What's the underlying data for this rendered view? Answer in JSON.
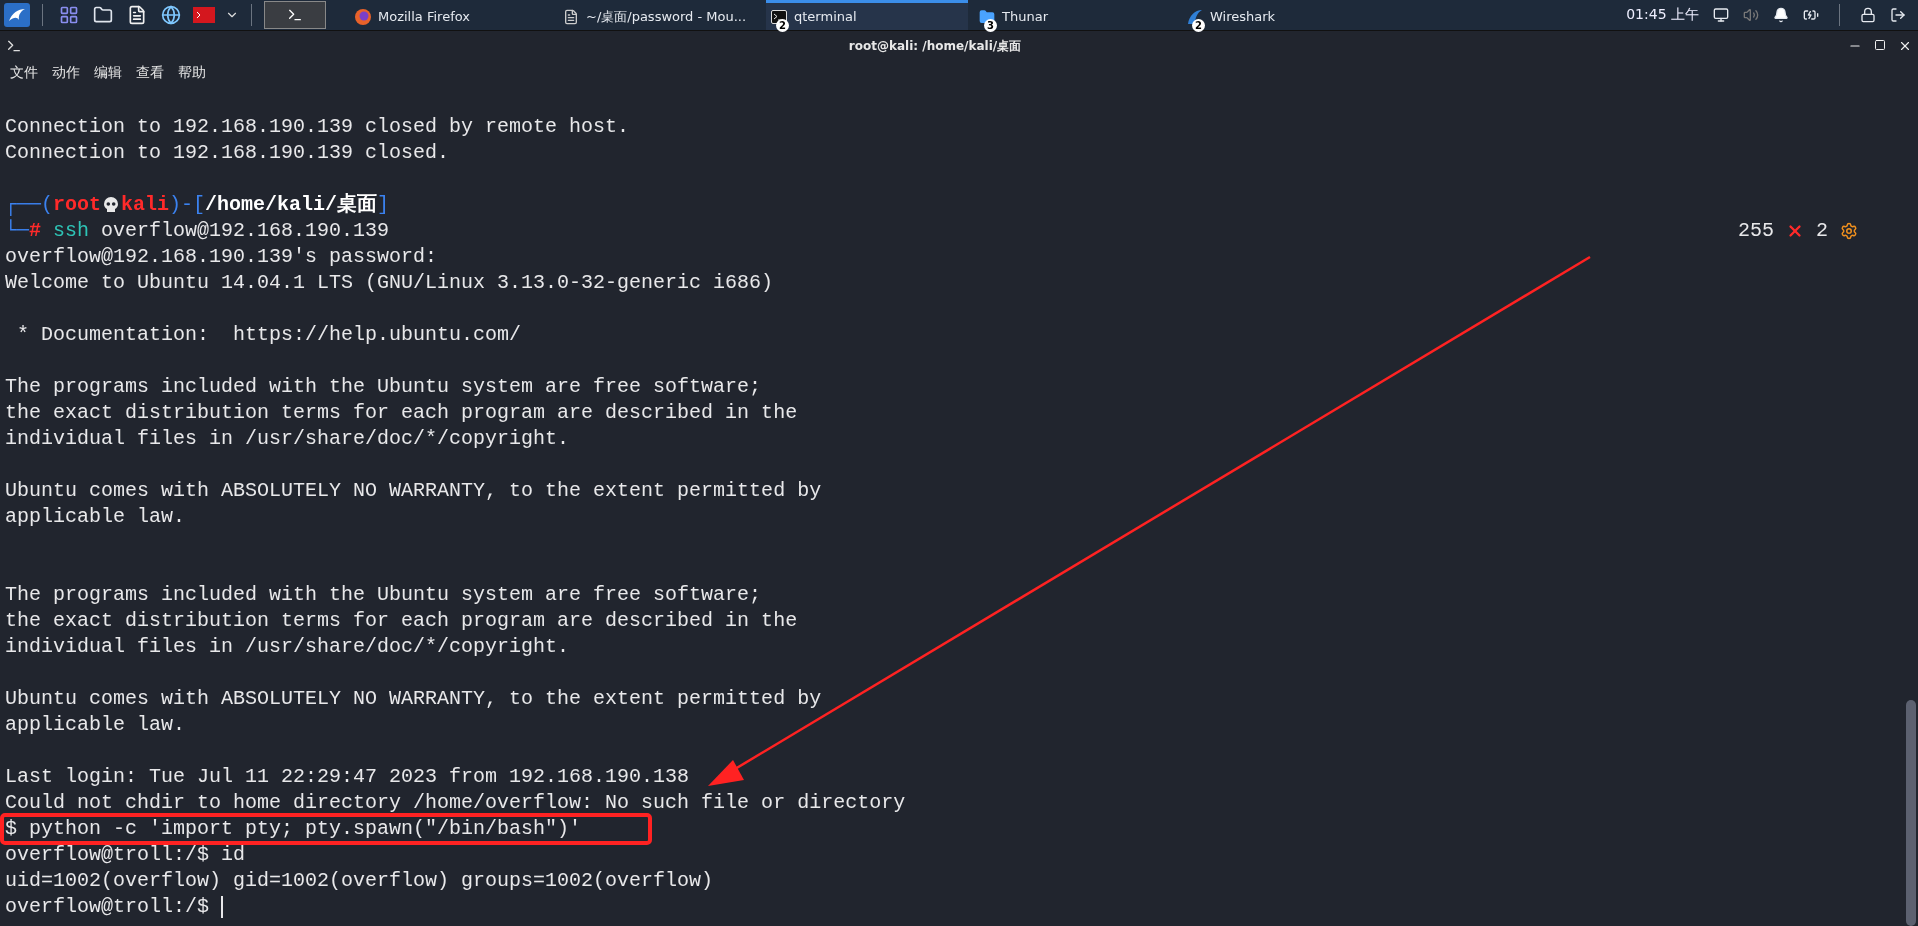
{
  "taskbar": {
    "launchers": [
      {
        "kind": "desktop"
      },
      {
        "kind": "files"
      },
      {
        "kind": "editor"
      },
      {
        "kind": "browser"
      },
      {
        "kind": "terminal"
      }
    ],
    "tasks": [
      {
        "kind": "firefox",
        "label": "Mozilla Firefox",
        "selected": false
      },
      {
        "kind": "document",
        "label": "~/桌面/password - Mou...",
        "selected": false
      },
      {
        "kind": "terminal",
        "label": "qterminal",
        "badge": "2",
        "selected": true
      },
      {
        "kind": "folder",
        "label": "Thunar",
        "badge": "3",
        "selected": false
      },
      {
        "kind": "wireshark",
        "label": "Wireshark",
        "badge": "2",
        "selected": false
      }
    ],
    "clock": "01:45 上午"
  },
  "window": {
    "title": "root@kali: /home/kali/桌面",
    "menu": [
      "文件",
      "动作",
      "编辑",
      "查看",
      "帮助"
    ]
  },
  "terminal": {
    "lines": [
      {
        "kind": "text",
        "text": "Connection to 192.168.190.139 closed by remote host."
      },
      {
        "kind": "text",
        "text": "Connection to 192.168.190.139 closed."
      },
      {
        "kind": "blank"
      },
      {
        "kind": "prompt",
        "segments": [
          {
            "kind": "frame",
            "text": "┌──("
          },
          {
            "kind": "user",
            "text": "root"
          },
          {
            "kind": "skull"
          },
          {
            "kind": "user",
            "text": "kali"
          },
          {
            "kind": "frame",
            "text": ")-["
          },
          {
            "kind": "path",
            "text": "/home/kali/桌面"
          },
          {
            "kind": "frame",
            "text": "]"
          }
        ]
      },
      {
        "kind": "prompt",
        "segments": [
          {
            "kind": "frame",
            "text": "└─"
          },
          {
            "kind": "symbol",
            "text": "#"
          },
          {
            "kind": "command",
            "text": " ssh"
          },
          {
            "kind": "arg",
            "text": " overflow@192.168.190.139"
          }
        ],
        "right": {
          "status": "255",
          "jobs": "2"
        }
      },
      {
        "kind": "text",
        "text": "overflow@192.168.190.139's password:"
      },
      {
        "kind": "text",
        "text": "Welcome to Ubuntu 14.04.1 LTS (GNU/Linux 3.13.0-32-generic i686)"
      },
      {
        "kind": "blank"
      },
      {
        "kind": "text",
        "text": " * Documentation:  https://help.ubuntu.com/"
      },
      {
        "kind": "blank"
      },
      {
        "kind": "text",
        "text": "The programs included with the Ubuntu system are free software;"
      },
      {
        "kind": "text",
        "text": "the exact distribution terms for each program are described in the"
      },
      {
        "kind": "text",
        "text": "individual files in /usr/share/doc/*/copyright."
      },
      {
        "kind": "blank"
      },
      {
        "kind": "text",
        "text": "Ubuntu comes with ABSOLUTELY NO WARRANTY, to the extent permitted by"
      },
      {
        "kind": "text",
        "text": "applicable law."
      },
      {
        "kind": "blank"
      },
      {
        "kind": "blank"
      },
      {
        "kind": "text",
        "text": "The programs included with the Ubuntu system are free software;"
      },
      {
        "kind": "text",
        "text": "the exact distribution terms for each program are described in the"
      },
      {
        "kind": "text",
        "text": "individual files in /usr/share/doc/*/copyright."
      },
      {
        "kind": "blank"
      },
      {
        "kind": "text",
        "text": "Ubuntu comes with ABSOLUTELY NO WARRANTY, to the extent permitted by"
      },
      {
        "kind": "text",
        "text": "applicable law."
      },
      {
        "kind": "blank"
      },
      {
        "kind": "text",
        "text": "Last login: Tue Jul 11 22:29:47 2023 from 192.168.190.138"
      },
      {
        "kind": "text",
        "text": "Could not chdir to home directory /home/overflow: No such file or directory"
      },
      {
        "kind": "text",
        "text": "$ python -c 'import pty; pty.spawn(\"/bin/bash\")'",
        "highlighted": true
      },
      {
        "kind": "text",
        "text": "overflow@troll:/$ id"
      },
      {
        "kind": "text",
        "text": "uid=1002(overflow) gid=1002(overflow) groups=1002(overflow)"
      },
      {
        "kind": "text",
        "text": "overflow@troll:/$ ",
        "cursor": true
      }
    ]
  }
}
